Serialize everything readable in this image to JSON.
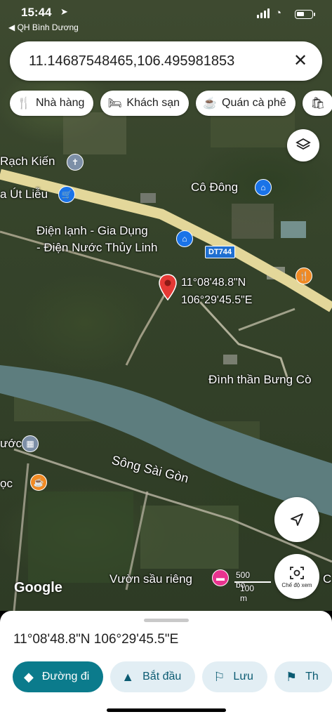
{
  "status_bar": {
    "time": "15:44",
    "back_app": "◀ QH Bình Dương"
  },
  "search": {
    "query": "11.14687548465,106.495981853",
    "close_icon": "close-icon"
  },
  "chips": [
    {
      "label": "Nhà hàng",
      "icon": "restaurant-icon"
    },
    {
      "label": "Khách sạn",
      "icon": "hotel-icon"
    },
    {
      "label": "Quán cà phê",
      "icon": "cafe-icon"
    },
    {
      "label": "",
      "icon": "shopping-icon"
    }
  ],
  "map": {
    "places": {
      "rach_kien": "Rạch Kiến",
      "ut_lieu": "a Út Liễu",
      "co_dong": "Cô Đông",
      "dien_lanh_1": "Điện lạnh - Gia Dụng",
      "dien_lanh_2": "- Điện Nước Thủy Linh",
      "dinh_than": "Đình thần Bưng Cò",
      "song_sai_gon": "Sông Sài Gòn",
      "nuoc": "ước",
      "ngoc": "ọc",
      "vuon_sau_rieng": "Vườn sầu riêng",
      "edge_c": "C"
    },
    "road_shield": "DT744",
    "pin": {
      "lat_label": "11°08'48.8\"N",
      "lng_label": "106°29'45.5\"E"
    },
    "attribution": "Google",
    "scale": {
      "imperial": "500 bộ",
      "metric": "100 m"
    },
    "lens_label": "Chế độ xem"
  },
  "sheet": {
    "coordinates": "11°08'48.8\"N 106°29'45.5\"E",
    "actions": [
      {
        "label": "Đường đi",
        "icon": "directions-icon"
      },
      {
        "label": "Bắt đầu",
        "icon": "navigate-icon"
      },
      {
        "label": "Lưu",
        "icon": "bookmark-icon"
      },
      {
        "label": "Th",
        "icon": "flag-icon"
      }
    ]
  },
  "colors": {
    "accent": "#0b7b8c",
    "pin": "#e53935",
    "road": "#e8dca0"
  }
}
